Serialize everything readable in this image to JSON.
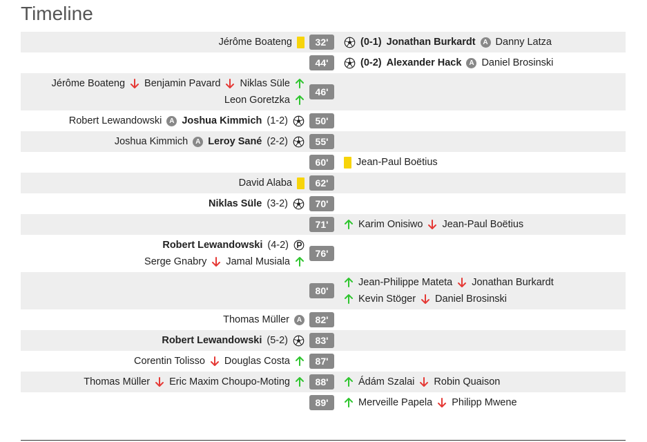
{
  "title": "Timeline",
  "colors": {
    "row_shade": "#eeeeee",
    "minute_badge": "#888888",
    "yellow_card": "#f7d40a",
    "sub_in": "#2ec52e",
    "sub_out": "#e53935"
  },
  "events": [
    {
      "minute": "32'",
      "shaded": true,
      "home": [
        [
          {
            "t": "text",
            "v": "Jérôme Boateng"
          },
          {
            "t": "icon",
            "v": "yellow-card"
          }
        ]
      ],
      "away": [
        [
          {
            "t": "icon",
            "v": "goal"
          },
          {
            "t": "text",
            "v": "(0-1)",
            "b": true
          },
          {
            "t": "text",
            "v": "Jonathan Burkardt",
            "b": true
          },
          {
            "t": "icon",
            "v": "assist"
          },
          {
            "t": "text",
            "v": "Danny Latza"
          }
        ]
      ]
    },
    {
      "minute": "44'",
      "shaded": false,
      "home": [],
      "away": [
        [
          {
            "t": "icon",
            "v": "goal"
          },
          {
            "t": "text",
            "v": "(0-2)",
            "b": true
          },
          {
            "t": "text",
            "v": "Alexander Hack",
            "b": true
          },
          {
            "t": "icon",
            "v": "assist"
          },
          {
            "t": "text",
            "v": "Daniel Brosinski"
          }
        ]
      ]
    },
    {
      "minute": "46'",
      "shaded": true,
      "home": [
        [
          {
            "t": "text",
            "v": "Jérôme Boateng"
          },
          {
            "t": "icon",
            "v": "sub-out"
          },
          {
            "t": "text",
            "v": "Benjamin Pavard"
          },
          {
            "t": "icon",
            "v": "sub-out"
          },
          {
            "t": "text",
            "v": "Niklas Süle"
          },
          {
            "t": "icon",
            "v": "sub-in"
          }
        ],
        [
          {
            "t": "text",
            "v": "Leon Goretzka"
          },
          {
            "t": "icon",
            "v": "sub-in"
          }
        ]
      ],
      "away": []
    },
    {
      "minute": "50'",
      "shaded": false,
      "home": [
        [
          {
            "t": "text",
            "v": "Robert Lewandowski"
          },
          {
            "t": "icon",
            "v": "assist"
          },
          {
            "t": "text",
            "v": "Joshua Kimmich",
            "b": true
          },
          {
            "t": "text",
            "v": "(1-2)"
          },
          {
            "t": "icon",
            "v": "goal"
          }
        ]
      ],
      "away": []
    },
    {
      "minute": "55'",
      "shaded": true,
      "home": [
        [
          {
            "t": "text",
            "v": "Joshua Kimmich"
          },
          {
            "t": "icon",
            "v": "assist"
          },
          {
            "t": "text",
            "v": "Leroy Sané",
            "b": true
          },
          {
            "t": "text",
            "v": "(2-2)"
          },
          {
            "t": "icon",
            "v": "goal"
          }
        ]
      ],
      "away": []
    },
    {
      "minute": "60'",
      "shaded": false,
      "home": [],
      "away": [
        [
          {
            "t": "icon",
            "v": "yellow-card"
          },
          {
            "t": "text",
            "v": "Jean-Paul Boëtius"
          }
        ]
      ]
    },
    {
      "minute": "62'",
      "shaded": true,
      "home": [
        [
          {
            "t": "text",
            "v": "David Alaba"
          },
          {
            "t": "icon",
            "v": "yellow-card"
          }
        ]
      ],
      "away": []
    },
    {
      "minute": "70'",
      "shaded": false,
      "home": [
        [
          {
            "t": "text",
            "v": "Niklas Süle",
            "b": true
          },
          {
            "t": "text",
            "v": "(3-2)"
          },
          {
            "t": "icon",
            "v": "goal"
          }
        ]
      ],
      "away": []
    },
    {
      "minute": "71'",
      "shaded": true,
      "home": [],
      "away": [
        [
          {
            "t": "icon",
            "v": "sub-in"
          },
          {
            "t": "text",
            "v": "Karim Onisiwo"
          },
          {
            "t": "icon",
            "v": "sub-out"
          },
          {
            "t": "text",
            "v": "Jean-Paul Boëtius"
          }
        ]
      ]
    },
    {
      "minute": "76'",
      "shaded": false,
      "home": [
        [
          {
            "t": "text",
            "v": "Robert Lewandowski",
            "b": true
          },
          {
            "t": "text",
            "v": "(4-2)"
          },
          {
            "t": "icon",
            "v": "penalty"
          }
        ],
        [
          {
            "t": "text",
            "v": "Serge Gnabry"
          },
          {
            "t": "icon",
            "v": "sub-out"
          },
          {
            "t": "text",
            "v": "Jamal Musiala"
          },
          {
            "t": "icon",
            "v": "sub-in"
          }
        ]
      ],
      "away": []
    },
    {
      "minute": "80'",
      "shaded": true,
      "home": [],
      "away": [
        [
          {
            "t": "icon",
            "v": "sub-in"
          },
          {
            "t": "text",
            "v": "Jean-Philippe Mateta"
          },
          {
            "t": "icon",
            "v": "sub-out"
          },
          {
            "t": "text",
            "v": "Jonathan Burkardt"
          }
        ],
        [
          {
            "t": "icon",
            "v": "sub-in"
          },
          {
            "t": "text",
            "v": "Kevin Stöger"
          },
          {
            "t": "icon",
            "v": "sub-out"
          },
          {
            "t": "text",
            "v": "Daniel Brosinski"
          }
        ]
      ]
    },
    {
      "minute": "82'",
      "shaded": false,
      "home": [
        [
          {
            "t": "text",
            "v": "Thomas Müller"
          },
          {
            "t": "icon",
            "v": "assist"
          }
        ]
      ],
      "away": []
    },
    {
      "minute": "83'",
      "shaded": true,
      "home": [
        [
          {
            "t": "text",
            "v": "Robert Lewandowski",
            "b": true
          },
          {
            "t": "text",
            "v": "(5-2)"
          },
          {
            "t": "icon",
            "v": "goal"
          }
        ]
      ],
      "away": []
    },
    {
      "minute": "87'",
      "shaded": false,
      "home": [
        [
          {
            "t": "text",
            "v": "Corentin Tolisso"
          },
          {
            "t": "icon",
            "v": "sub-out"
          },
          {
            "t": "text",
            "v": "Douglas Costa"
          },
          {
            "t": "icon",
            "v": "sub-in"
          }
        ]
      ],
      "away": []
    },
    {
      "minute": "88'",
      "shaded": true,
      "home": [
        [
          {
            "t": "text",
            "v": "Thomas Müller"
          },
          {
            "t": "icon",
            "v": "sub-out"
          },
          {
            "t": "text",
            "v": "Eric Maxim Choupo-Moting"
          },
          {
            "t": "icon",
            "v": "sub-in"
          }
        ]
      ],
      "away": [
        [
          {
            "t": "icon",
            "v": "sub-in"
          },
          {
            "t": "text",
            "v": "Ádám Szalai"
          },
          {
            "t": "icon",
            "v": "sub-out"
          },
          {
            "t": "text",
            "v": "Robin Quaison"
          }
        ]
      ]
    },
    {
      "minute": "89'",
      "shaded": false,
      "home": [],
      "away": [
        [
          {
            "t": "icon",
            "v": "sub-in"
          },
          {
            "t": "text",
            "v": "Merveille Papela"
          },
          {
            "t": "icon",
            "v": "sub-out"
          },
          {
            "t": "text",
            "v": "Philipp Mwene"
          }
        ]
      ]
    }
  ]
}
